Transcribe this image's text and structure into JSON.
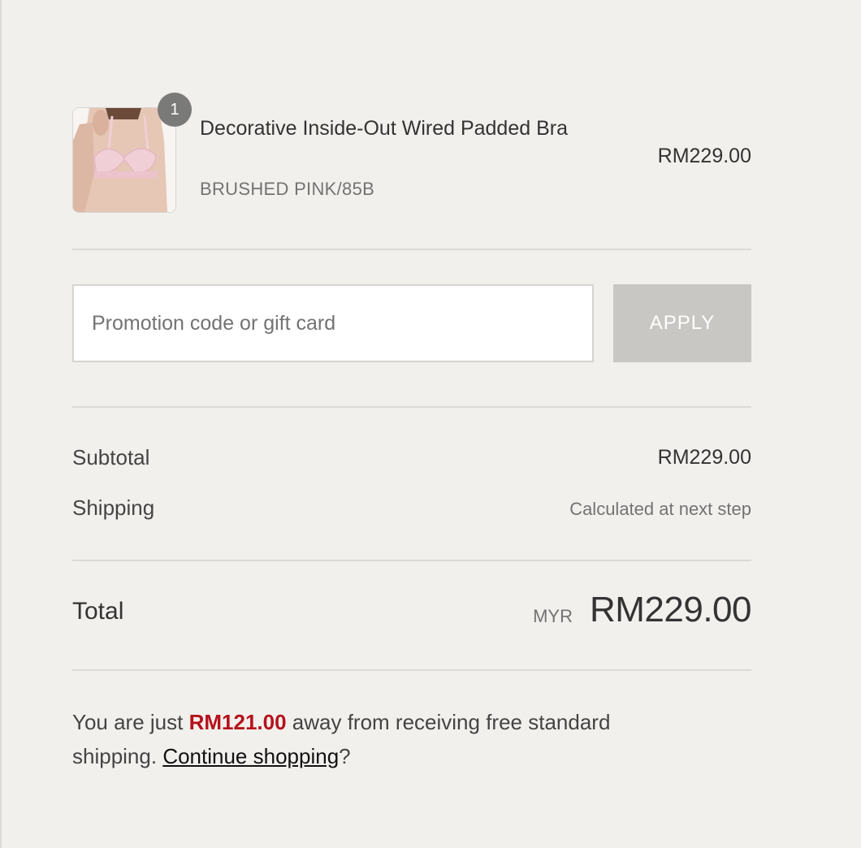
{
  "cart": {
    "items": [
      {
        "quantity": "1",
        "name": "Decorative Inside-Out Wired Padded Bra",
        "variant": "BRUSHED PINK/85B",
        "price": "RM229.00"
      }
    ]
  },
  "promo": {
    "placeholder": "Promotion code or gift card",
    "value": "",
    "apply_label": "APPLY"
  },
  "summary": {
    "subtotal_label": "Subtotal",
    "subtotal_value": "RM229.00",
    "shipping_label": "Shipping",
    "shipping_value": "Calculated at next step",
    "total_label": "Total",
    "total_currency": "MYR",
    "total_value": "RM229.00"
  },
  "free_shipping": {
    "prefix": "You are just ",
    "amount": "RM121.00",
    "middle": " away from receiving free standard shipping. ",
    "link_label": "Continue shopping",
    "suffix": "?"
  },
  "colors": {
    "background": "#f2f0ed",
    "apply_button": "#c8c7c3",
    "badge": "#7a7a78",
    "highlight_amount": "#b5121b",
    "product_swatch": "#f0cfd6"
  },
  "icons": {
    "product_thumbnail": "product-image-bra"
  }
}
